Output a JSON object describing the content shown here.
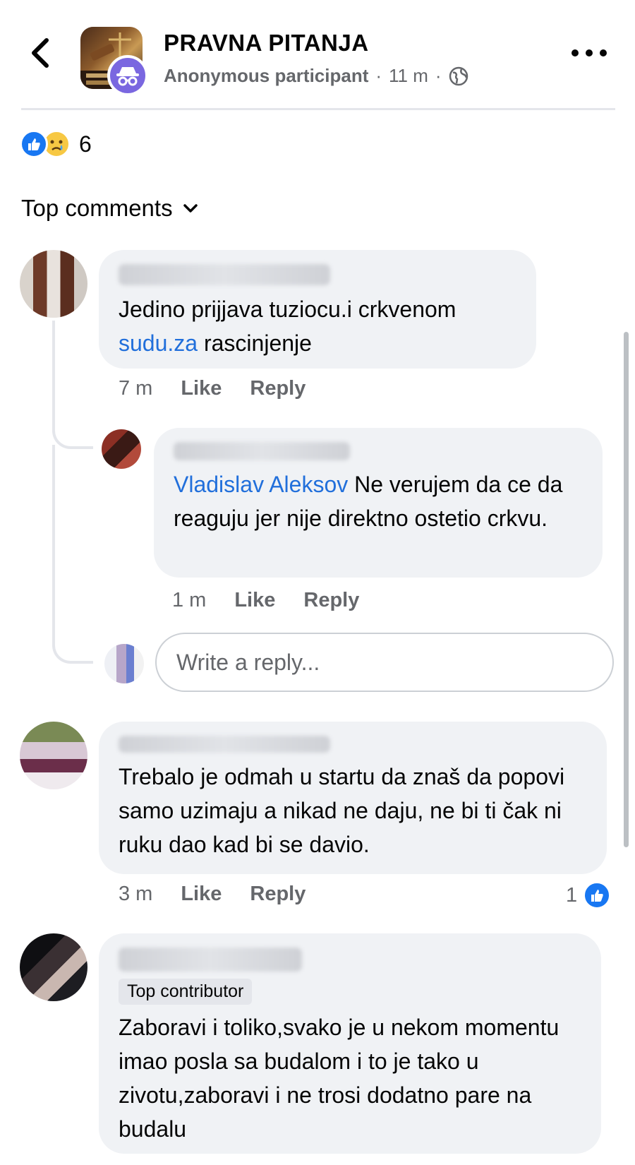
{
  "header": {
    "group_name": "PRAVNA PITANJA",
    "author": "Anonymous participant",
    "time": "11 m",
    "privacy_icon": "globe-icon",
    "back_icon": "chevron-left-icon",
    "more_icon": "more-dots-icon"
  },
  "reactions": {
    "types": [
      "like",
      "sad"
    ],
    "count": "6"
  },
  "sort": {
    "label": "Top comments",
    "icon": "chevron-down-icon"
  },
  "comments": [
    {
      "text_prefix": "Jedino prijjava tuziocu.i crkvenom ",
      "link": "sudu.za",
      "text_suffix": " rascinjenje",
      "time": "7 m",
      "like_label": "Like",
      "reply_label": "Reply"
    },
    {
      "mention": "Vladislav Aleksov",
      "text": " Ne verujem da ce da reaguju jer nije direktno ostetio crkvu.",
      "time": "1 m",
      "like_label": "Like",
      "reply_label": "Reply"
    },
    {
      "text": "Trebalo je odmah u startu da znaš da popovi samo uzimaju a nikad ne daju, ne bi ti čak ni ruku dao kad bi se davio.",
      "time": "3 m",
      "like_label": "Like",
      "reply_label": "Reply",
      "like_count": "1"
    },
    {
      "badge": "Top contributor",
      "text": "Zaboravi i toliko,svako je u nekom momentu imao posla sa budalom i to je tako u zivotu,zaboravi i ne trosi dodatno pare na budalu"
    }
  ],
  "reply_box": {
    "placeholder": "Write a reply..."
  },
  "colors": {
    "link": "#216fdb",
    "like_blue": "#1877f2",
    "bubble_bg": "#f0f2f5",
    "secondary_text": "#65676b"
  }
}
